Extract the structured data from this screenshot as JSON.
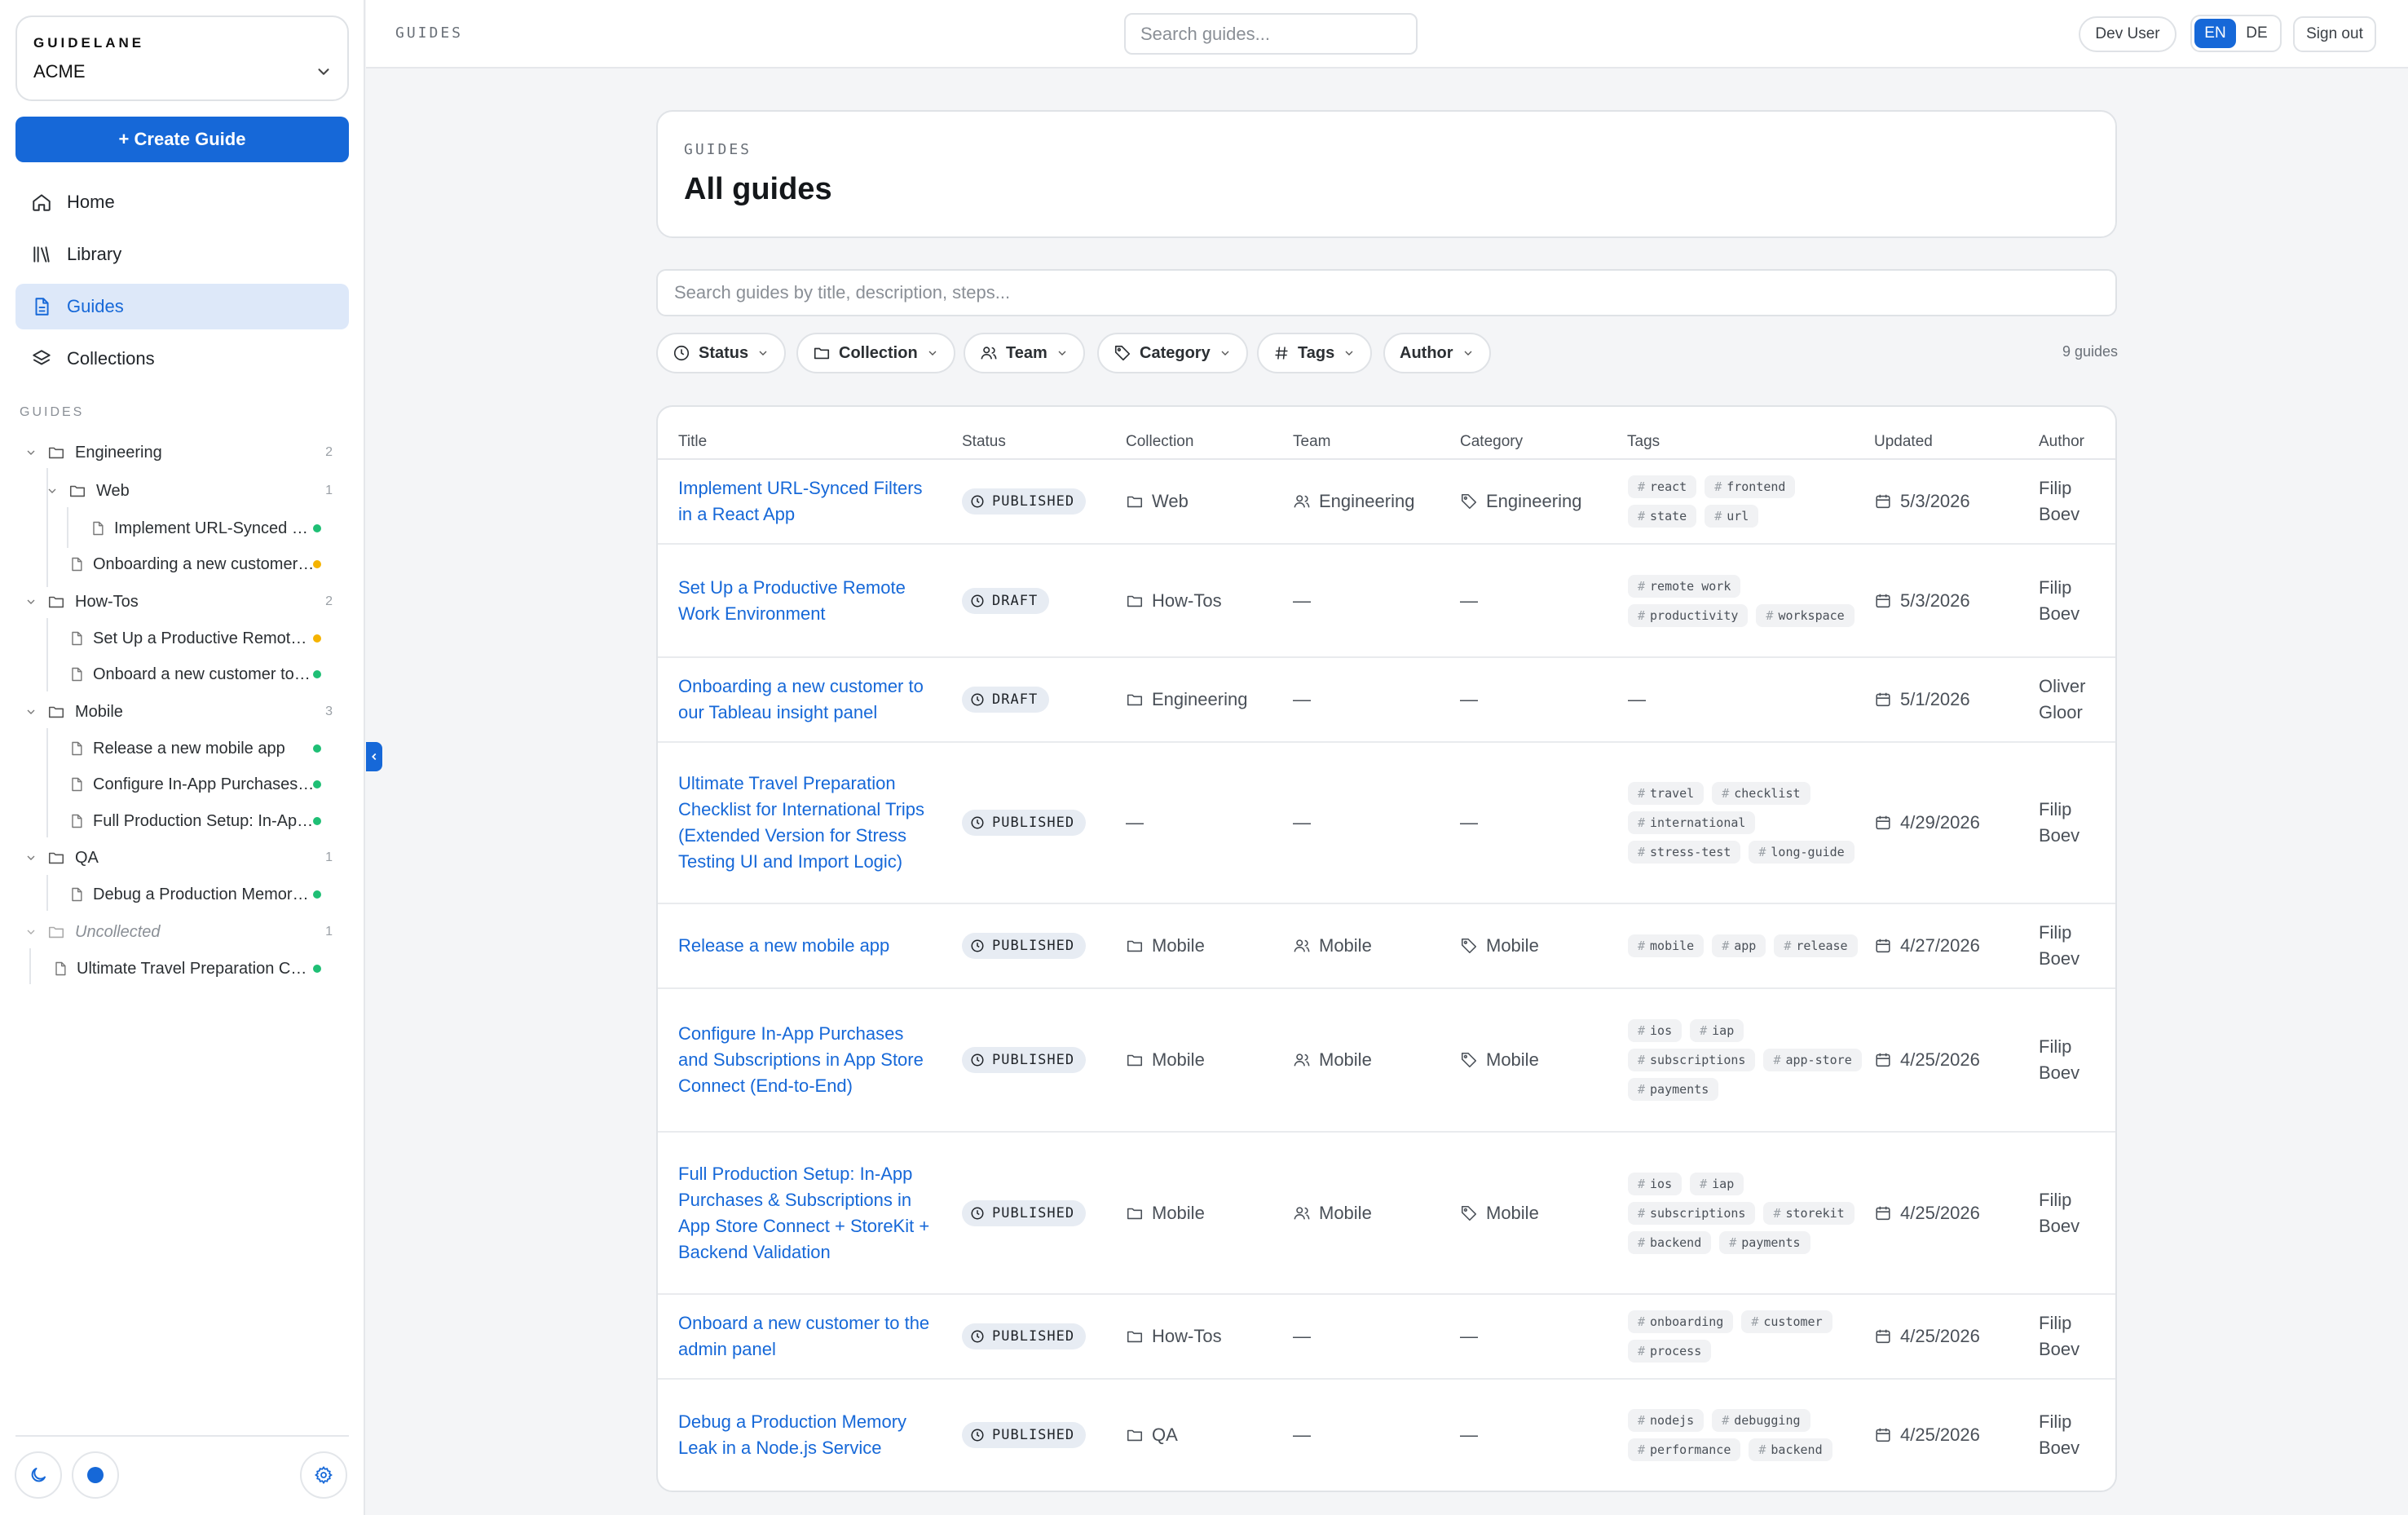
{
  "workspace": {
    "brand": "GUIDELANE",
    "name": "ACME"
  },
  "create_label": "+ Create Guide",
  "nav": [
    {
      "label": "Home",
      "icon": "home-icon"
    },
    {
      "label": "Library",
      "icon": "library-icon"
    },
    {
      "label": "Guides",
      "icon": "document-icon"
    },
    {
      "label": "Collections",
      "icon": "layers-icon"
    }
  ],
  "sidebar_section": "GUIDES",
  "tree": [
    {
      "label": "Engineering",
      "count": "2"
    },
    {
      "label": "Web",
      "count": "1"
    },
    {
      "label": "Implement URL-Synced Filters in a React App"
    },
    {
      "label": "Onboarding a new customer to our Tableau insight panel"
    },
    {
      "label": "How-Tos",
      "count": "2"
    },
    {
      "label": "Set Up a Productive Remote Work Environment"
    },
    {
      "label": "Onboard a new customer to the admin panel"
    },
    {
      "label": "Mobile",
      "count": "3"
    },
    {
      "label": "Release a new mobile app"
    },
    {
      "label": "Configure In-App Purchases and Subscriptions"
    },
    {
      "label": "Full Production Setup: In-App Purchases"
    },
    {
      "label": "QA",
      "count": "1"
    },
    {
      "label": "Debug a Production Memory Leak"
    },
    {
      "label": "Uncollected",
      "count": "1"
    },
    {
      "label": "Ultimate Travel Preparation Checklist"
    }
  ],
  "status_colors": {
    "published": "#1fbf75",
    "draft": "#f5b300",
    "accent": "#1668d8"
  },
  "topbar": {
    "title": "GUIDES",
    "search_placeholder": "Search guides...",
    "user": "Dev User",
    "lang_en": "EN",
    "lang_de": "DE",
    "sign_out": "Sign out"
  },
  "page": {
    "eyebrow": "GUIDES",
    "title": "All guides",
    "search_placeholder": "Search guides by title, description, steps...",
    "count": "9 guides"
  },
  "filters": [
    "Status",
    "Collection",
    "Team",
    "Category",
    "Tags",
    "Author"
  ],
  "columns": [
    "Title",
    "Status",
    "Collection",
    "Team",
    "Category",
    "Tags",
    "Updated",
    "Author"
  ],
  "rows": [
    {
      "title": "Implement URL-Synced Filters in a React App",
      "status": "PUBLISHED",
      "collection": "Web",
      "team": "Engineering",
      "category": "Engineering",
      "tags": [
        "react",
        "frontend",
        "state",
        "url"
      ],
      "updated": "5/3/2026",
      "author": "Filip Boev"
    },
    {
      "title": "Set Up a Productive Remote Work Environment",
      "status": "DRAFT",
      "collection": "How-Tos",
      "team": "—",
      "category": "—",
      "tags": [
        "remote work",
        "productivity",
        "workspace"
      ],
      "updated": "5/3/2026",
      "author": "Filip Boev"
    },
    {
      "title": "Onboarding a new customer to our Tableau insight panel",
      "status": "DRAFT",
      "collection": "Engineering",
      "team": "—",
      "category": "—",
      "tags": [],
      "tags_empty": "—",
      "updated": "5/1/2026",
      "author": "Oliver Gloor"
    },
    {
      "title": "Ultimate Travel Preparation Checklist for International Trips (Extended Version for Stress Testing UI and Import Logic)",
      "status": "PUBLISHED",
      "collection": "—",
      "team": "—",
      "category": "—",
      "tags": [
        "travel",
        "checklist",
        "international",
        "stress-test",
        "long-guide"
      ],
      "updated": "4/29/2026",
      "author": "Filip Boev"
    },
    {
      "title": "Release a new mobile app",
      "status": "PUBLISHED",
      "collection": "Mobile",
      "team": "Mobile",
      "category": "Mobile",
      "tags": [
        "mobile",
        "app",
        "release"
      ],
      "updated": "4/27/2026",
      "author": "Filip Boev"
    },
    {
      "title": "Configure In-App Purchases and Subscriptions in App Store Connect (End-to-End)",
      "status": "PUBLISHED",
      "collection": "Mobile",
      "team": "Mobile",
      "category": "Mobile",
      "tags": [
        "ios",
        "iap",
        "subscriptions",
        "app-store",
        "payments"
      ],
      "updated": "4/25/2026",
      "author": "Filip Boev"
    },
    {
      "title": "Full Production Setup: In-App Purchases & Subscriptions in App Store Connect + StoreKit + Backend Validation",
      "status": "PUBLISHED",
      "collection": "Mobile",
      "team": "Mobile",
      "category": "Mobile",
      "tags": [
        "ios",
        "iap",
        "subscriptions",
        "storekit",
        "backend",
        "payments"
      ],
      "updated": "4/25/2026",
      "author": "Filip Boev"
    },
    {
      "title": "Onboard a new customer to the admin panel",
      "status": "PUBLISHED",
      "collection": "How-Tos",
      "team": "—",
      "category": "—",
      "tags": [
        "onboarding",
        "customer",
        "process"
      ],
      "updated": "4/25/2026",
      "author": "Filip Boev"
    },
    {
      "title": "Debug a Production Memory Leak in a Node.js Service",
      "status": "PUBLISHED",
      "collection": "QA",
      "team": "—",
      "category": "—",
      "tags": [
        "nodejs",
        "debugging",
        "performance",
        "backend"
      ],
      "updated": "4/25/2026",
      "author": "Filip Boev"
    }
  ]
}
